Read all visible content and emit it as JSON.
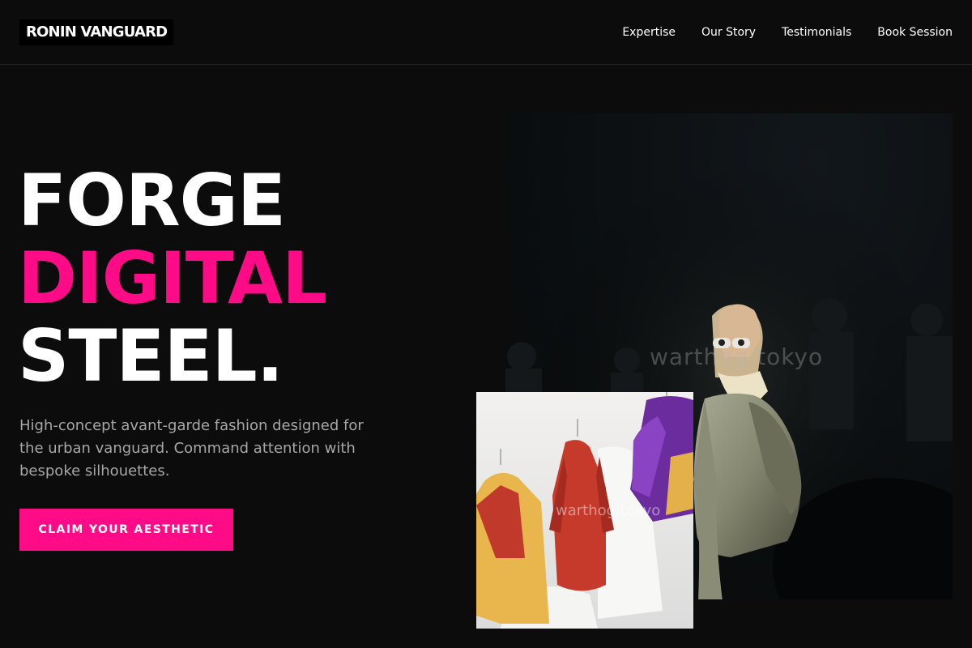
{
  "brand": {
    "name": "RONIN VANGUARD"
  },
  "nav": {
    "items": [
      "Expertise",
      "Our Story",
      "Testimonials",
      "Book Session"
    ]
  },
  "hero": {
    "headline": {
      "line1": "FORGE",
      "line2": "DIGITAL",
      "line3": "STEEL."
    },
    "subtext": "High-concept avant-garde fashion designed for the urban vanguard. Command attention with bespoke silhouettes.",
    "cta_label": "CLAIM YOUR AESTHETIC"
  },
  "images": {
    "runway_watermark": "warthog.tokyo",
    "rack_watermark": "warthog.tokyo"
  },
  "colors": {
    "accent": "#ff0a87",
    "background": "#0c0c0c",
    "muted_text": "#a7a7a7"
  }
}
